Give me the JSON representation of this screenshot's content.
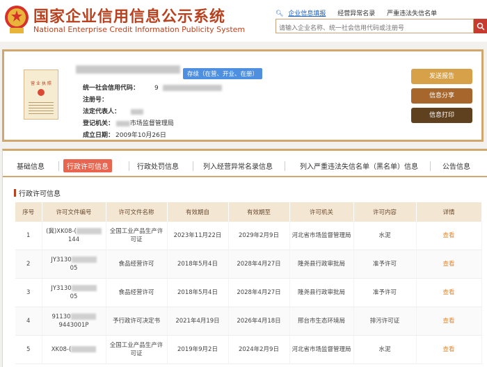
{
  "header": {
    "title_cn": "国家企业信用信息公示系统",
    "title_en": "National Enterprise Credit Information Publicity System",
    "search_tabs": [
      "企业信息填报",
      "经营异常名录",
      "严重违法失信名单"
    ],
    "search_placeholder": "请输入企业名称、统一社会信用代码或注册号",
    "search_icon": "search-icon"
  },
  "company": {
    "status": "存续（在营、开业、在册）",
    "fields": [
      {
        "label": "统一社会信用代码：",
        "value": "9"
      },
      {
        "label": "注册号：",
        "value": ""
      },
      {
        "label": "法定代表人：",
        "value": ""
      },
      {
        "label": "登记机关：",
        "value": "市场监督管理局"
      },
      {
        "label": "成立日期：",
        "value": "2009年10月26日"
      }
    ],
    "license_text": "营 业 执 照",
    "buttons": {
      "send": "发送报告",
      "share": "信息分享",
      "print": "信息打印"
    },
    "button_colors": {
      "send": "#d7a14a",
      "share": "#a7672c",
      "print": "#5f4120"
    }
  },
  "tabs": [
    "基础信息",
    "行政许可信息",
    "行政处罚信息",
    "列入经营异常名录信息",
    "列入严重违法失信名单（黑名单）信息",
    "公告信息"
  ],
  "active_tab": "行政许可信息",
  "section_title": "行政许可信息",
  "table": {
    "headers": [
      "序号",
      "许可文件编号",
      "许可文件名称",
      "有效期自",
      "有效期至",
      "许可机关",
      "许可内容",
      "详情"
    ],
    "rows": [
      {
        "no": "1",
        "code_a": "(冀)XK08-(",
        "code_b": "144",
        "name": "全国工业产品生产许可证",
        "from": "2023年11月22日",
        "to": "2029年2月9日",
        "authority": "河北省市场监督管理局",
        "content": "水泥",
        "detail": "查看"
      },
      {
        "no": "2",
        "code_a": "JY3130",
        "code_b": "05",
        "name": "食品经营许可",
        "from": "2018年5月4日",
        "to": "2028年4月27日",
        "authority": "隆尧县行政审批局",
        "content": "准予许可",
        "detail": "查看"
      },
      {
        "no": "3",
        "code_a": "JY3130",
        "code_b": "05",
        "name": "食品经营许可",
        "from": "2018年5月4日",
        "to": "2028年4月27日",
        "authority": "隆尧县行政审批局",
        "content": "准予许可",
        "detail": "查看"
      },
      {
        "no": "4",
        "code_a": "91130",
        "code_b": "9443001P",
        "name": "予行政许可决定书",
        "from": "2021年4月19日",
        "to": "2026年4月18日",
        "authority": "邢台市生态环境局",
        "content": "排污许可证",
        "detail": "查看"
      },
      {
        "no": "5",
        "code_a": "XK08-(",
        "code_b": "",
        "name": "全国工业产品生产许可证",
        "from": "2019年9月2日",
        "to": "2024年2月9日",
        "authority": "河北省市场监督管理局",
        "content": "水泥",
        "detail": "查看"
      }
    ]
  }
}
